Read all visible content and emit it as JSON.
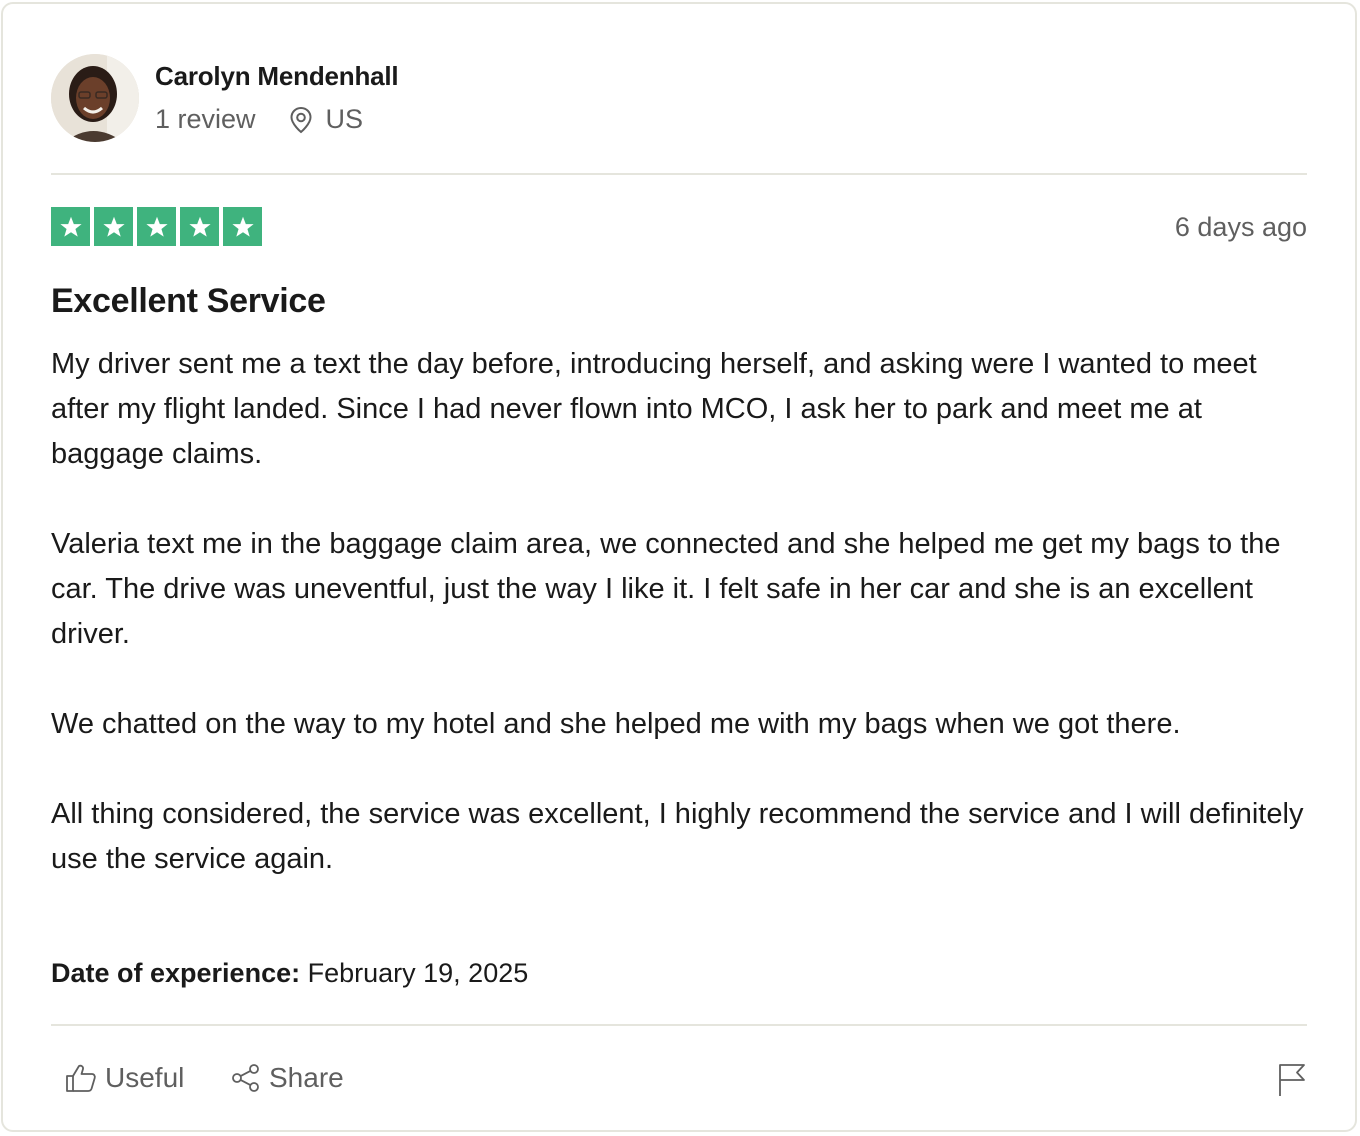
{
  "reviewer": {
    "name": "Carolyn Mendenhall",
    "review_count": "1 review",
    "location": "US"
  },
  "review": {
    "rating": 5,
    "rating_color": "#3fb37e",
    "posted": "6 days ago",
    "title": "Excellent Service",
    "paragraphs": [
      "My driver sent me a text the day before, introducing herself, and asking were I wanted to meet after my flight landed. Since I had never flown into MCO, I ask her to park and meet me at baggage claims.",
      "Valeria text me in the baggage claim area, we connected and she helped me get my bags to the car. The drive was uneventful, just the way I like it. I felt safe in her car and she is an excellent driver.",
      "We chatted on the way to my hotel and she helped me with my bags when we got there.",
      "All thing considered, the service was excellent, I highly recommend the service and I will definitely use the service again."
    ],
    "experience_label": "Date of experience:",
    "experience_date": "February 19, 2025"
  },
  "actions": {
    "useful_label": "Useful",
    "share_label": "Share",
    "useful_icon": "thumbs-up-icon",
    "share_icon": "share-icon",
    "report_icon": "flag-icon"
  }
}
